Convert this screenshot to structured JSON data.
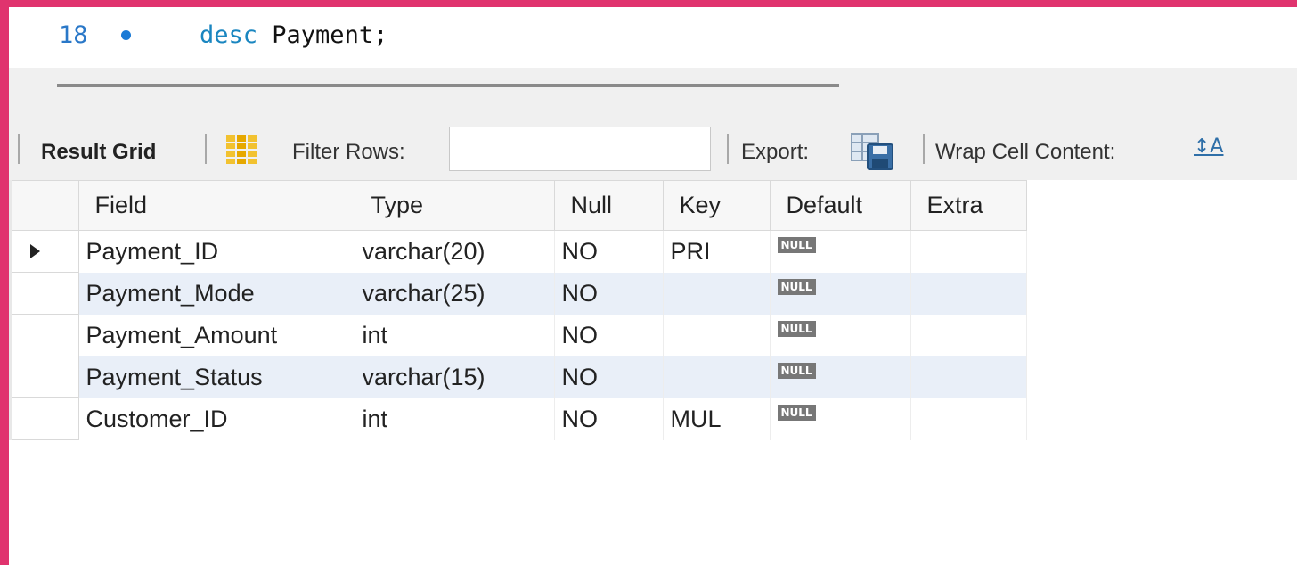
{
  "editor": {
    "line_number": "18",
    "keyword": "desc",
    "statement_rest": " Payment;"
  },
  "toolbar": {
    "result_grid_label": "Result Grid",
    "filter_rows_label": "Filter Rows:",
    "filter_value": "",
    "export_label": "Export:",
    "wrap_label": "Wrap Cell Content:",
    "wrap_icon_glyph": "↕A"
  },
  "grid": {
    "columns": [
      "Field",
      "Type",
      "Null",
      "Key",
      "Default",
      "Extra"
    ],
    "null_badge": "NULL",
    "rows": [
      {
        "field": "Payment_ID",
        "type": "varchar(20)",
        "null": "NO",
        "key": "PRI",
        "extra": ""
      },
      {
        "field": "Payment_Mode",
        "type": "varchar(25)",
        "null": "NO",
        "key": "",
        "extra": ""
      },
      {
        "field": "Payment_Amount",
        "type": "int",
        "null": "NO",
        "key": "",
        "extra": ""
      },
      {
        "field": "Payment_Status",
        "type": "varchar(15)",
        "null": "NO",
        "key": "",
        "extra": ""
      },
      {
        "field": "Customer_ID",
        "type": "int",
        "null": "NO",
        "key": "MUL",
        "extra": ""
      }
    ]
  },
  "colors": {
    "border_accent": "#e0336e",
    "keyword": "#1a86c0",
    "alt_row": "#e9eff8"
  }
}
